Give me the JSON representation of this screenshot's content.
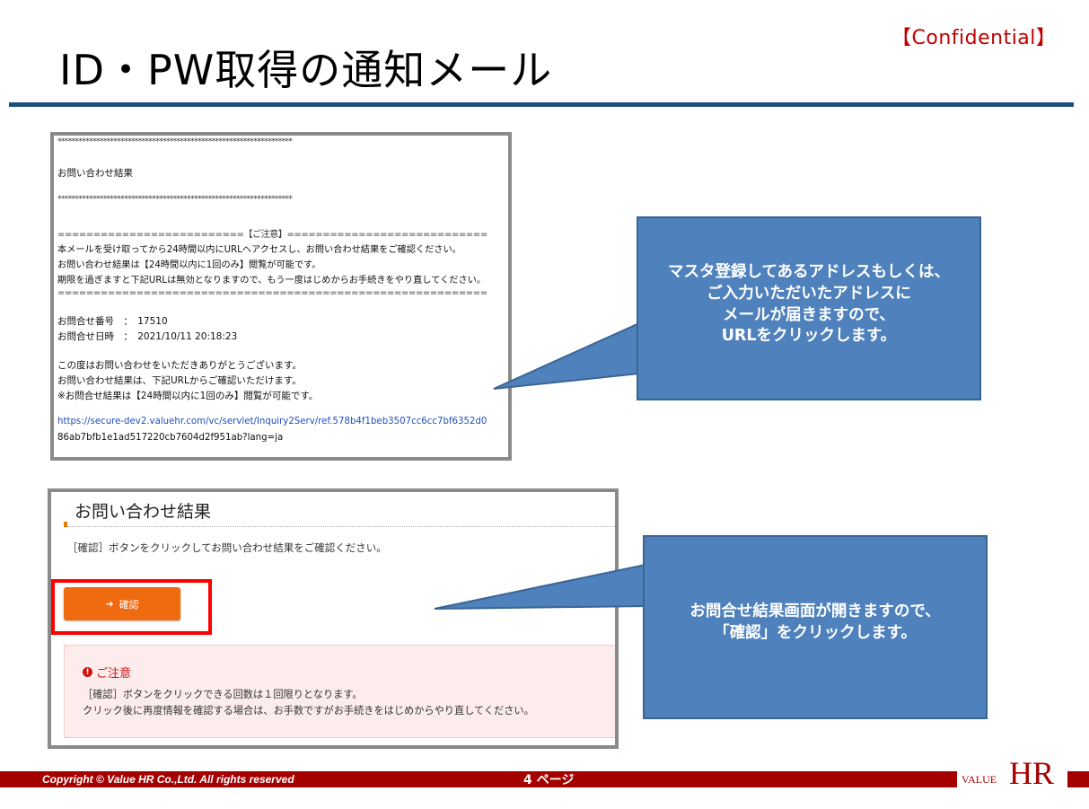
{
  "header": {
    "confidential": "【Confidential】",
    "title": "ID・PW取得の通知メール"
  },
  "email": {
    "lines": [
      "*******************************************************************",
      "お問い合わせ結果",
      "*******************************************************************",
      "==========================【ご注意】============================",
      "本メールを受け取ってから24時間以内にURLへアクセスし、お問い合わせ結果をご確認ください。",
      "お問い合わせ結果は【24時間以内に1回のみ】閲覧が可能です。",
      "期限を過ぎますと下記URLは無効となりますので、もう一度はじめからお手続きをやり直してください。",
      "============================================================",
      "お問合せ番号　：　17510",
      "お問合せ日時　：　2021/10/11 20:18:23",
      "この度はお問い合わせをいただきありがとうございます。",
      "お問い合わせ結果は、下記URLからご確認いただけます。",
      "※お問合せ結果は【24時間以内に1回のみ】閲覧が可能です。",
      "https://secure-dev2.valuehr.com/vc/servlet/Inquiry2Serv/ref.578b4f1beb3507cc6cc7bf6352d0",
      "86ab7bfb1e1ad517220cb7604d2f951ab?lang=ja"
    ]
  },
  "result": {
    "title": "お問い合わせ結果",
    "instruction": "［確認］ボタンをクリックしてお問い合わせ結果をご確認ください。",
    "confirm_arrow": "➔",
    "confirm_label": "確認",
    "notice_icon": "!",
    "notice_title": "ご注意",
    "notice_line1": "［確認］ボタンをクリックできる回数は１回限りとなります。",
    "notice_line2": "クリック後に再度情報を確認する場合は、お手数ですがお手続きをはじめからやり直してください。"
  },
  "callouts": {
    "first": [
      "マスタ登録してあるアドレスもしくは、",
      "ご入力いただいたアドレスに",
      "メールが届きますので、",
      "URLをクリックします。"
    ],
    "second": [
      "お問合せ結果画面が開きますので、",
      "「確認」をクリックします。"
    ]
  },
  "footer": {
    "copyright": "Copyright © Value HR Co.,Ltd. All rights reserved",
    "page": "4 ページ",
    "logo_small": "VALUE",
    "logo_large": "HR"
  },
  "colors": {
    "title_rule": "#1f4e79",
    "callout": "#4f81bd",
    "footer": "#a50000",
    "confirm_button": "#f06a10",
    "highlight": "#ff0000"
  }
}
